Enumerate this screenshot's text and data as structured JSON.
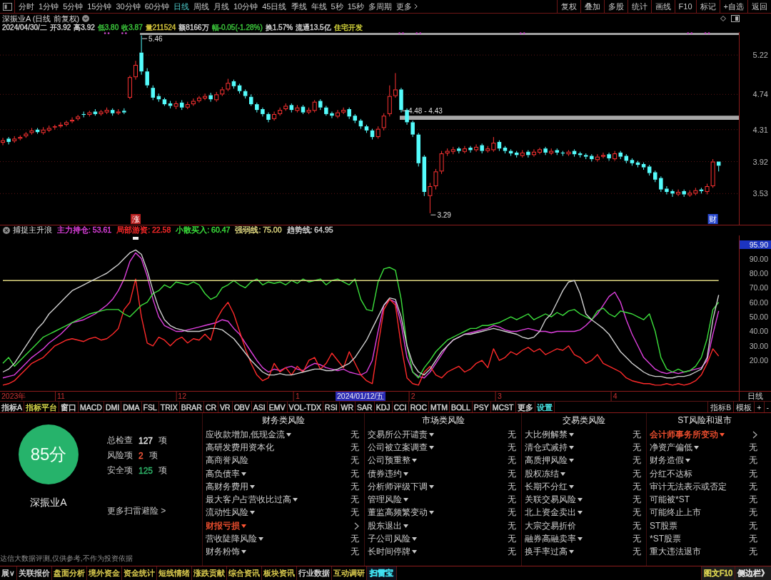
{
  "toolbar": {
    "periods": [
      {
        "label": "分时",
        "selected": false
      },
      {
        "label": "1分钟",
        "selected": false
      },
      {
        "label": "5分钟",
        "selected": false
      },
      {
        "label": "15分钟",
        "selected": false
      },
      {
        "label": "30分钟",
        "selected": false
      },
      {
        "label": "60分钟",
        "selected": false
      },
      {
        "label": "日线",
        "selected": true
      },
      {
        "label": "周线",
        "selected": false
      },
      {
        "label": "月线",
        "selected": false
      },
      {
        "label": "10分钟",
        "selected": false
      },
      {
        "label": "45日线",
        "selected": false
      },
      {
        "label": "季线",
        "selected": false
      },
      {
        "label": "年线",
        "selected": false
      },
      {
        "label": "5秒",
        "selected": false
      },
      {
        "label": "15秒",
        "selected": false
      },
      {
        "label": "多周期",
        "selected": false
      }
    ],
    "more": "更多",
    "actions": [
      "复权",
      "叠加",
      "多股",
      "统计",
      "画线",
      "F10",
      "标记",
      "+自选",
      "返回"
    ]
  },
  "header": {
    "title": "深振业A (日线 前复权)",
    "quote": [
      {
        "text": "2024/04/30/二",
        "color": "#d4d4d4"
      },
      {
        "text": "开3.92",
        "color": "#d4d4d4"
      },
      {
        "text": "高3.92",
        "color": "#d4d4d4"
      },
      {
        "text": "低3.80",
        "color": "#3cc83c"
      },
      {
        "text": "收3.87",
        "color": "#3cc83c"
      },
      {
        "text": "量211524",
        "color": "#d8c83c"
      },
      {
        "text": "额8166万",
        "color": "#d4d4d4"
      },
      {
        "text": "幅-0.05(-1.28%)",
        "color": "#3cc83c"
      },
      {
        "text": "换1.57%",
        "color": "#d4d4d4"
      },
      {
        "text": "流通13.5亿",
        "color": "#d4d4d4"
      },
      {
        "text": "住宅开发",
        "color": "#d8d83c"
      }
    ]
  },
  "kline": {
    "price_axis": [
      "5.22",
      "4.74",
      "4.31",
      "3.92",
      "3.53"
    ],
    "notes": [
      "5.46",
      "4.48 - 4.43",
      "3.29"
    ],
    "badges": [
      {
        "label": "涨",
        "color": "#b82020"
      },
      {
        "label": "财",
        "color": "#2a4ad0"
      }
    ]
  },
  "indicator": {
    "legend": [
      "主力持仓: 53.61",
      "局部游资: 22.58",
      "小散买入: 60.47",
      "强弱线: 75.00",
      "趋势线: 64.95"
    ],
    "chart_data": {
      "type": "line",
      "title": "捕捉主升浪",
      "categories": [
        null,
        null,
        null,
        null,
        null,
        null,
        null,
        null,
        null,
        null,
        "11",
        null,
        null,
        null,
        null,
        null,
        null,
        null,
        null,
        null,
        null,
        null,
        null,
        null,
        null,
        null,
        null,
        null,
        null,
        null,
        null,
        "12",
        null,
        null,
        null,
        null,
        null,
        null,
        null,
        null,
        null,
        null,
        null,
        null,
        null,
        null,
        null,
        null,
        null,
        null,
        null,
        "1",
        null,
        null,
        null,
        null,
        null,
        null,
        null,
        null,
        null,
        null,
        null,
        null,
        null,
        null,
        null,
        null,
        null,
        null,
        null,
        "2",
        null,
        null,
        null,
        null,
        null,
        null,
        null,
        null,
        null,
        null,
        null,
        null,
        null,
        null,
        "3",
        null,
        null,
        null,
        null,
        null,
        null,
        null,
        null,
        null,
        null,
        null,
        null,
        null,
        null,
        null,
        null,
        null,
        null,
        null,
        "4",
        null,
        null,
        null,
        null,
        null,
        null,
        null,
        null,
        null,
        null,
        null,
        null,
        null,
        null,
        null,
        null,
        null,
        null
      ],
      "ylim": [
        -1,
        106
      ],
      "yticks": [
        {
          "value": 90,
          "label": "90.00"
        },
        {
          "value": 80,
          "label": "80.00"
        },
        {
          "value": 70,
          "label": "70.00"
        },
        {
          "value": 60,
          "label": "60.00"
        },
        {
          "value": 50,
          "label": "50.00"
        },
        {
          "value": 40,
          "label": "40.00"
        },
        {
          "value": 30,
          "label": "30.00"
        },
        {
          "value": 20,
          "label": "20.00"
        }
      ],
      "series": [
        {
          "color": "#e040e0",
          "values": [
            8,
            9,
            10,
            14,
            18,
            22,
            25,
            28,
            32,
            35,
            38,
            42,
            46,
            47,
            48,
            50,
            52,
            55,
            58,
            62,
            68,
            76,
            88,
            94,
            90,
            78,
            62,
            50,
            44,
            42,
            40,
            40,
            41,
            42,
            43,
            44,
            45,
            46,
            48,
            47,
            42,
            38,
            32,
            26,
            20,
            15,
            12,
            14,
            13,
            15,
            16,
            14,
            13,
            16,
            18,
            17,
            15,
            14,
            13,
            14,
            12,
            11,
            10,
            12,
            20,
            40,
            58,
            62,
            60,
            45,
            22,
            12,
            9,
            8,
            12,
            18,
            24,
            30,
            34,
            36,
            38,
            39,
            40,
            41,
            42,
            44,
            43,
            41,
            40,
            40,
            41,
            42,
            41,
            40,
            40,
            39,
            40,
            40,
            40,
            40,
            41,
            44,
            48,
            52,
            58,
            64,
            67,
            60,
            48,
            38,
            30,
            22,
            18,
            14,
            12,
            11,
            12,
            11,
            12,
            13,
            14,
            15,
            20,
            38,
            54
          ]
        },
        {
          "color": "#ff2a2a",
          "values": [
            3,
            4,
            6,
            10,
            14,
            18,
            20,
            22,
            26,
            30,
            32,
            34,
            35,
            34,
            33,
            35,
            36,
            34,
            35,
            38,
            42,
            55,
            60,
            76,
            50,
            32,
            30,
            36,
            34,
            30,
            34,
            36,
            32,
            35,
            34,
            38,
            34,
            48,
            55,
            60,
            52,
            40,
            28,
            18,
            10,
            6,
            8,
            18,
            12,
            15,
            10,
            16,
            12,
            20,
            22,
            14,
            18,
            25,
            20,
            15,
            26,
            18,
            10,
            6,
            4,
            30,
            55,
            62,
            58,
            30,
            8,
            4,
            3,
            12,
            16,
            10,
            8,
            12,
            14,
            16,
            12,
            14,
            18,
            20,
            15,
            28,
            20,
            22,
            26,
            24,
            27,
            29,
            26,
            28,
            24,
            26,
            28,
            27,
            30,
            24,
            22,
            18,
            20,
            24,
            18,
            16,
            14,
            12,
            8,
            6,
            5,
            4,
            4,
            3,
            3,
            4,
            3,
            4,
            3,
            4,
            6,
            10,
            18,
            28,
            23
          ]
        },
        {
          "color": "#3ce03c",
          "values": [
            18,
            22,
            16,
            20,
            24,
            28,
            32,
            36,
            38,
            40,
            42,
            44,
            46,
            48,
            50,
            52,
            53,
            54,
            55,
            55,
            55,
            52,
            50,
            54,
            58,
            60,
            66,
            68,
            72,
            70,
            74,
            73,
            72,
            74,
            72,
            66,
            62,
            64,
            70,
            72,
            75,
            72,
            70,
            74,
            76,
            72,
            74,
            73,
            74,
            72,
            75,
            73,
            76,
            74,
            75,
            76,
            72,
            75,
            76,
            74,
            72,
            76,
            62,
            55,
            54,
            74,
            83,
            84,
            82,
            62,
            30,
            12,
            8,
            15,
            20,
            26,
            30,
            34,
            36,
            38,
            40,
            42,
            42,
            44,
            44,
            45,
            46,
            48,
            50,
            48,
            50,
            52,
            48,
            50,
            52,
            50,
            53,
            51,
            54,
            55,
            52,
            50,
            48,
            54,
            56,
            52,
            50,
            54,
            53,
            52,
            50,
            48,
            52,
            40,
            22,
            14,
            12,
            14,
            12,
            13,
            16,
            22,
            35,
            55,
            60
          ]
        },
        {
          "color": "#e0d880",
          "values": [
            75,
            75,
            75,
            75,
            75,
            75,
            75,
            75,
            75,
            75,
            75,
            75,
            75,
            75,
            75,
            75,
            75,
            75,
            75,
            75,
            75,
            75,
            75,
            75,
            75,
            75,
            75,
            75,
            75,
            75,
            75,
            75,
            75,
            75,
            75,
            75,
            75,
            75,
            75,
            75,
            75,
            75,
            75,
            75,
            75,
            75,
            75,
            75,
            75,
            75,
            75,
            75,
            75,
            75,
            75,
            75,
            75,
            75,
            75,
            75,
            75,
            75,
            75,
            75,
            75,
            75,
            75,
            75,
            75,
            75,
            75,
            75,
            75,
            75,
            75,
            75,
            75,
            75,
            75,
            75,
            75,
            75,
            75,
            75,
            75,
            75,
            75,
            75,
            75,
            75,
            75,
            75,
            75,
            75,
            75,
            75,
            75,
            75,
            75,
            75,
            75,
            75,
            75,
            75,
            75,
            75,
            75,
            75,
            75,
            75,
            75,
            75,
            75,
            75,
            75,
            75,
            75,
            75,
            75,
            75,
            75,
            75,
            75,
            75,
            75
          ]
        },
        {
          "color": "#d0d0d0",
          "values": [
            12,
            14,
            18,
            24,
            30,
            36,
            42,
            46,
            52,
            56,
            60,
            64,
            68,
            70,
            72,
            74,
            76,
            78,
            80,
            83,
            86,
            90,
            94,
            96,
            93,
            82,
            68,
            56,
            48,
            44,
            42,
            41,
            40,
            40,
            40,
            41,
            42,
            42,
            41,
            38,
            35,
            30,
            25,
            20,
            16,
            12,
            10,
            10,
            11,
            10,
            10,
            11,
            12,
            13,
            14,
            14,
            13,
            13,
            14,
            16,
            18,
            22,
            28,
            34,
            42,
            50,
            58,
            63,
            62,
            50,
            30,
            18,
            12,
            10,
            14,
            20,
            26,
            30,
            34,
            36,
            38,
            38,
            39,
            40,
            41,
            42,
            41,
            40,
            39,
            38,
            36,
            35,
            36,
            40,
            48,
            52,
            60,
            68,
            74,
            75,
            66,
            52,
            48,
            45,
            42,
            38,
            32,
            26,
            22,
            18,
            15,
            12,
            10,
            9,
            9,
            8,
            8,
            9,
            9,
            10,
            12,
            14,
            22,
            48,
            65
          ]
        }
      ],
      "annotations": [
        "95.90"
      ]
    }
  },
  "date_axis": {
    "year": "2023年",
    "cursor": "2024/01/12/五",
    "period": "日线"
  },
  "indicator_tabs": {
    "left": [
      {
        "label": "指标A",
        "color": "#d8d8d8"
      },
      {
        "label": "指标平台",
        "color": "#d8d84a"
      },
      {
        "label": "窗口",
        "color": "#d8d8d8"
      },
      {
        "label": "MACD",
        "color": "#d8d8d8"
      },
      {
        "label": "DMI",
        "color": "#d8d8d8"
      },
      {
        "label": "DMA",
        "color": "#d8d8d8"
      },
      {
        "label": "FSL",
        "color": "#d8d8d8"
      },
      {
        "label": "TRIX",
        "color": "#d8d8d8"
      },
      {
        "label": "BRAR",
        "color": "#d8d8d8"
      },
      {
        "label": "CR",
        "color": "#d8d8d8"
      },
      {
        "label": "VR",
        "color": "#d8d8d8"
      },
      {
        "label": "OBV",
        "color": "#d8d8d8"
      },
      {
        "label": "ASI",
        "color": "#d8d8d8"
      },
      {
        "label": "EMV",
        "color": "#d8d8d8"
      },
      {
        "label": "VOL-TDX",
        "color": "#d8d8d8"
      },
      {
        "label": "RSI",
        "color": "#d8d8d8"
      },
      {
        "label": "WR",
        "color": "#d8d8d8"
      },
      {
        "label": "SAR",
        "color": "#d8d8d8"
      },
      {
        "label": "KDJ",
        "color": "#d8d8d8"
      },
      {
        "label": "CCI",
        "color": "#d8d8d8"
      },
      {
        "label": "ROC",
        "color": "#d8d8d8"
      },
      {
        "label": "MTM",
        "color": "#d8d8d8"
      },
      {
        "label": "BOLL",
        "color": "#d8d8d8"
      },
      {
        "label": "PSY",
        "color": "#d8d8d8"
      },
      {
        "label": "MCST",
        "color": "#d8d8d8"
      },
      {
        "label": "更多",
        "color": "#d8d8d8"
      },
      {
        "label": "设置",
        "color": "#48e0e0"
      }
    ],
    "right": [
      {
        "label": "指标B"
      },
      {
        "label": "模板"
      },
      {
        "label": "+"
      },
      {
        "label": "-"
      }
    ]
  },
  "risk_scan": {
    "score": "85分",
    "stock": "深振业A",
    "stats": [
      {
        "label": "总检查",
        "value": "127",
        "unit": "项",
        "color": "#e6e6e6"
      },
      {
        "label": "风险项",
        "value": "2",
        "unit": "项",
        "color": "#ff5a3c"
      },
      {
        "label": "安全项",
        "value": "125",
        "unit": "项",
        "color": "#2fb56a"
      }
    ],
    "more_link": "更多扫雷避险 >",
    "disclaimer": "达信大数据评测,仅供参考,不作为投资依据",
    "columns": [
      {
        "title": "财务类风险",
        "items": [
          {
            "label": "应收款增加,低现金流",
            "caret": true,
            "risk": false,
            "result": "无"
          },
          {
            "label": "高研发费用资本化",
            "caret": false,
            "risk": false,
            "result": "无"
          },
          {
            "label": "高商誉风险",
            "caret": false,
            "risk": false,
            "result": "无"
          },
          {
            "label": "高负债率",
            "caret": true,
            "risk": false,
            "result": "无"
          },
          {
            "label": "高财务费用",
            "caret": true,
            "risk": false,
            "result": "无"
          },
          {
            "label": "最大客户占营收比过高",
            "caret": true,
            "risk": false,
            "result": "无"
          },
          {
            "label": "流动性风险",
            "caret": true,
            "risk": false,
            "result": "无"
          },
          {
            "label": "财报亏损",
            "caret": true,
            "risk": true
          },
          {
            "label": "营收陡降风险",
            "caret": true,
            "risk": false,
            "result": "无"
          },
          {
            "label": "财务粉饰",
            "caret": true,
            "risk": false,
            "result": "无"
          }
        ]
      },
      {
        "title": "市场类风险",
        "items": [
          {
            "label": "交易所公开谴责",
            "caret": true,
            "risk": false,
            "result": "无"
          },
          {
            "label": "公司被立案调查",
            "caret": true,
            "risk": false,
            "result": "无"
          },
          {
            "label": "公司预重整",
            "caret": true,
            "risk": false,
            "result": "无"
          },
          {
            "label": "债券违约",
            "caret": true,
            "risk": false,
            "result": "无"
          },
          {
            "label": "分析师评级下调",
            "caret": true,
            "risk": false,
            "result": "无"
          },
          {
            "label": "管理风险",
            "caret": true,
            "risk": false,
            "result": "无"
          },
          {
            "label": "董监高频繁变动",
            "caret": true,
            "risk": false,
            "result": "无"
          },
          {
            "label": "股东退出",
            "caret": true,
            "risk": false,
            "result": "无"
          },
          {
            "label": "子公司风险",
            "caret": true,
            "risk": false,
            "result": "无"
          },
          {
            "label": "长时间停牌",
            "caret": true,
            "risk": false,
            "result": "无"
          }
        ]
      },
      {
        "title": "交易类风险",
        "items": [
          {
            "label": "大比例解禁",
            "caret": true,
            "risk": false,
            "result": "无"
          },
          {
            "label": "清仓式减持",
            "caret": true,
            "risk": false,
            "result": "无"
          },
          {
            "label": "高质押风险",
            "caret": true,
            "risk": false,
            "result": "无"
          },
          {
            "label": "股权冻结",
            "caret": true,
            "risk": false,
            "result": "无"
          },
          {
            "label": "长期不分红",
            "caret": true,
            "risk": false,
            "result": "无"
          },
          {
            "label": "关联交易风险",
            "caret": true,
            "risk": false,
            "result": "无"
          },
          {
            "label": "北上资金卖出",
            "caret": true,
            "risk": false,
            "result": "无"
          },
          {
            "label": "大宗交易折价",
            "caret": false,
            "risk": false,
            "result": "无"
          },
          {
            "label": "融券高融卖率",
            "caret": true,
            "risk": false,
            "result": "无"
          },
          {
            "label": "换手率过高",
            "caret": true,
            "risk": false,
            "result": "无"
          }
        ]
      },
      {
        "title": "ST风险和退市",
        "items": [
          {
            "label": "会计师事务所变动",
            "caret": true,
            "risk": true
          },
          {
            "label": "净资产偏低",
            "caret": true,
            "risk": false,
            "result": "无"
          },
          {
            "label": "财务造假",
            "caret": true,
            "risk": false,
            "result": "无"
          },
          {
            "label": "分红不达标",
            "caret": false,
            "risk": false,
            "result": "无"
          },
          {
            "label": "审计无法表示或否定",
            "caret": false,
            "risk": false,
            "result": "无"
          },
          {
            "label": "可能被*ST",
            "caret": false,
            "risk": false,
            "result": "无"
          },
          {
            "label": "可能终止上市",
            "caret": false,
            "risk": false,
            "result": "无"
          },
          {
            "label": "ST股票",
            "caret": false,
            "risk": false,
            "result": "无"
          },
          {
            "label": "*ST股票",
            "caret": false,
            "risk": false,
            "result": "无"
          },
          {
            "label": "重大违法退市",
            "caret": false,
            "risk": false,
            "result": "无"
          }
        ]
      }
    ]
  },
  "bottom_tabs": {
    "items": [
      {
        "label": "展∨",
        "color": "#d8d8d8",
        "selected": false
      },
      {
        "label": "关联报价",
        "color": "#d8d8d8",
        "selected": false
      },
      {
        "label": "盘面分析",
        "color": "#e0d050",
        "selected": false
      },
      {
        "label": "境外资金",
        "color": "#e0d050",
        "selected": false
      },
      {
        "label": "资金统计",
        "color": "#e0d050",
        "selected": false
      },
      {
        "label": "短线情绪",
        "color": "#e0d050",
        "selected": false
      },
      {
        "label": "涨跌贡献",
        "color": "#e0d050",
        "selected": false
      },
      {
        "label": "综合资讯",
        "color": "#e0d050",
        "selected": false
      },
      {
        "label": "板块资讯",
        "color": "#e0d050",
        "selected": false
      },
      {
        "label": "行业数据",
        "color": "#d8d8d8",
        "selected": false
      },
      {
        "label": "互动调研",
        "color": "#e0d050",
        "selected": false
      },
      {
        "label": "扫雷宝",
        "color": "#40e0f0",
        "selected": true
      }
    ],
    "right": [
      {
        "label": "图文F10",
        "color": "#d8d050"
      },
      {
        "label": "侧边栏》",
        "color": "#d8d8d8"
      }
    ]
  }
}
